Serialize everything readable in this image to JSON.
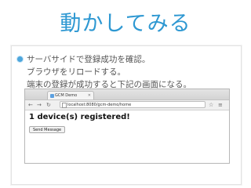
{
  "slide": {
    "title": "動かしてみる",
    "bullets": [
      "サーバサイドで登録成功を確認。",
      "ブラウザをリロードする。",
      "端末の登録が成功すると下記の画面になる。"
    ]
  },
  "browser": {
    "tab_title": "GCM Demo",
    "url": "localhost:8080/gcm-demo/home",
    "heading": "1 device(s) registered!",
    "send_button": "Send Message"
  },
  "colors": {
    "title": "#2e98d2",
    "bullet": "#4da6dc"
  }
}
